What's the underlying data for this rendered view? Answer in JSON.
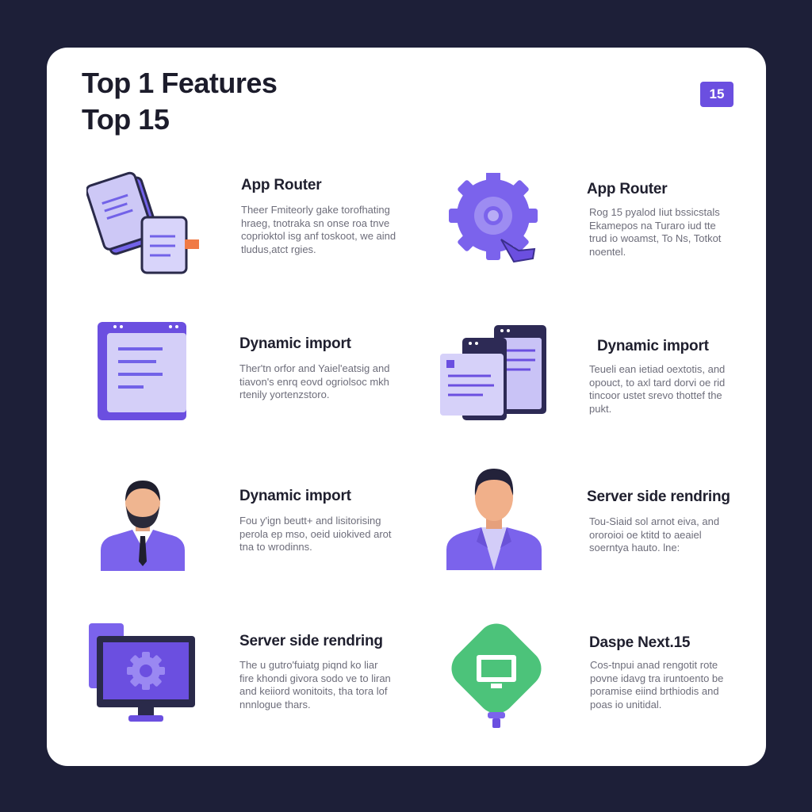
{
  "header": {
    "title_line1": "Top 1 Features",
    "title_line2": "Top 15",
    "badge": "15"
  },
  "features": [
    {
      "title": "App Router",
      "desc": [
        "Theer Fmiteorly gake torofhating",
        "hraeg, tnotraka sn onse roa tnve",
        "coprioktol isg anf toskoot, we aind",
        "tludus,atct rgies."
      ],
      "icon": "documents-icon"
    },
    {
      "title": "App Router",
      "desc": [
        "Rog 15 pyalod Iiut bssicstals",
        "Ekamepos na Turaro iud tte",
        "trud io woamst, To Ns, Totkot",
        "noentel."
      ],
      "icon": "gear-pointer-icon"
    },
    {
      "title": "Dynamic import",
      "desc": [
        "Ther'tn orfor and Yaiel'eatsig and",
        "tiavon's enrq eovd ogriolsoc mkh",
        "rtenily yortenzstoro."
      ],
      "icon": "browser-window-icon"
    },
    {
      "title": "Dynamic import",
      "desc": [
        "Teueli ean ietiad oextotis, and",
        "opouct, to axl tard dorvi oe rid",
        "tincoor ustet srevo thottef the",
        "pukt."
      ],
      "icon": "stacked-windows-icon"
    },
    {
      "title": "Dynamic import",
      "desc": [
        "Fou y'ign beutt+ and lisitorising",
        "perola ep mso, oeid uiokived arot",
        "tna to wrodinns."
      ],
      "icon": "bearded-man-avatar-icon"
    },
    {
      "title": "Server side rendring",
      "desc": [
        "Tou-Siaid sol arnot eiva, and",
        "ororoioi oe ktitd to aeaiel",
        "soerntya hauto. lne:"
      ],
      "icon": "man-avatar-icon"
    },
    {
      "title": "Server side rendring",
      "desc": [
        "The u gutro'fuiatg piqnd ko liar",
        "fire khondi givora sodo ve to liran",
        "and keiiord wonitoits, tha tora lof",
        "nnnlogue thars."
      ],
      "icon": "monitor-gear-icon"
    },
    {
      "title": "Daspe Next.15",
      "desc": [
        "Cos-tnpui anad rengotit rote",
        "povne idavg tra iruntoento be",
        "poramise eiind brthiodis and",
        "poas io unitidal."
      ],
      "icon": "green-monitor-pin-icon"
    }
  ],
  "colors": {
    "background": "#1d1f38",
    "card": "#ffffff",
    "accent_purple": "#6b4fe0",
    "light_purple": "#c7c1f3",
    "green": "#4cc37a"
  }
}
